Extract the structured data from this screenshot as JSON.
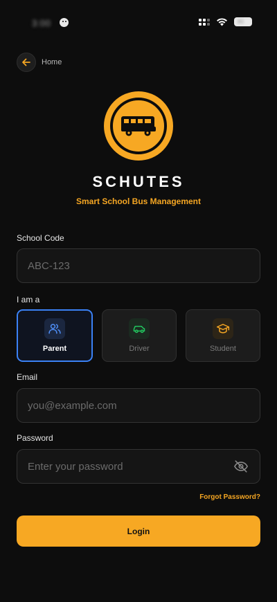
{
  "status_bar": {
    "time": "3:00"
  },
  "nav": {
    "back_label": "Home"
  },
  "brand": {
    "title": "SCHUTES",
    "subtitle": "Smart School Bus Management",
    "accent_color": "#f7a823"
  },
  "form": {
    "school_code": {
      "label": "School Code",
      "value": "",
      "placeholder": "ABC-123"
    },
    "role": {
      "label": "I am a",
      "selected": "Parent",
      "options": [
        {
          "label": "Parent",
          "icon": "users-icon",
          "color": "#3b82f6"
        },
        {
          "label": "Driver",
          "icon": "car-icon",
          "color": "#22c55e"
        },
        {
          "label": "Student",
          "icon": "graduation-cap-icon",
          "color": "#f5a623"
        }
      ]
    },
    "email": {
      "label": "Email",
      "value": "",
      "placeholder": "you@example.com"
    },
    "password": {
      "label": "Password",
      "value": "",
      "placeholder": "Enter your password",
      "toggle_icon": "eye-off-icon"
    },
    "forgot_label": "Forgot Password?",
    "submit_label": "Login"
  }
}
